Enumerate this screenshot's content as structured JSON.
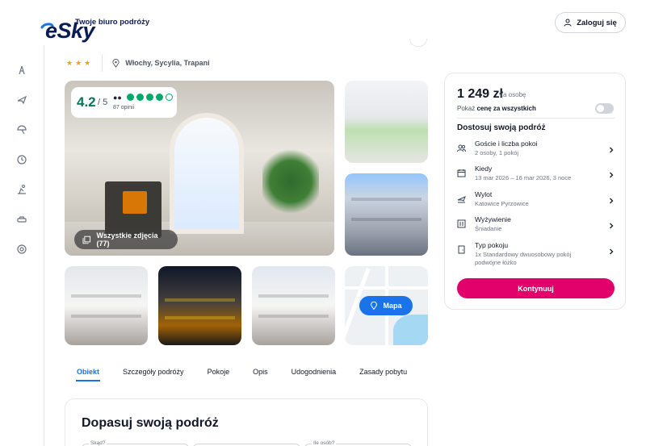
{
  "header": {
    "logo_text": "eSky",
    "tagline": "Twoje biuro podróży",
    "login_label": "Zaloguj się"
  },
  "sidebar": {
    "icons": [
      "flight-hotel-icon",
      "flight-icon",
      "beach-icon",
      "clock-icon",
      "sun-lounger-icon",
      "car-icon",
      "support-icon"
    ]
  },
  "hotel": {
    "stars": "★★★",
    "location": "Włochy, Sycylia, Trapani"
  },
  "rating": {
    "score": "4.2",
    "out_of": "/ 5",
    "bubbles_filled": 4,
    "bubbles_total": 5,
    "reviews": "87 opinii"
  },
  "gallery": {
    "all_photos_label": "Wszystkie zdjęcia (77)",
    "map_label": "Mapa"
  },
  "tabs": [
    {
      "label": "Obiekt",
      "active": true
    },
    {
      "label": "Szczegóły podróży",
      "active": false
    },
    {
      "label": "Pokoje",
      "active": false
    },
    {
      "label": "Opis",
      "active": false
    },
    {
      "label": "Udogodnienia",
      "active": false
    },
    {
      "label": "Zasady pobytu",
      "active": false
    }
  ],
  "adjust": {
    "title": "Dopasuj swoją podróż",
    "field_from": "Skąd?",
    "field_guests": "Ile osób?"
  },
  "booking": {
    "price": "1 249 zł",
    "price_suffix": "za osobę",
    "toggle_prefix": "Pokaż ",
    "toggle_bold": "cenę za wszystkich",
    "title": "Dostosuj swoją podróż",
    "options": [
      {
        "title": "Goście i liczba pokoi",
        "sub": "2 osoby, 1 pokój",
        "icon": "guests-icon"
      },
      {
        "title": "Kiedy",
        "sub": "13 mar 2026 – 16 mar 2026, 3 noce",
        "icon": "calendar-icon"
      },
      {
        "title": "Wylot",
        "sub": "Katowice Pyrzowice",
        "icon": "departure-icon"
      },
      {
        "title": "Wyżywienie",
        "sub": "Śniadanie",
        "icon": "meal-icon"
      },
      {
        "title": "Typ pokoju",
        "sub": "1x Standardowy dwuosobowy pokój podwójne łóżko",
        "icon": "room-icon"
      }
    ],
    "cta": "Kontynuuj"
  },
  "colors": {
    "brand_navy": "#0b1b55",
    "accent_blue": "#1a73e8",
    "cta_pink": "#e2006a",
    "tripadvisor_green": "#00aa6c"
  }
}
